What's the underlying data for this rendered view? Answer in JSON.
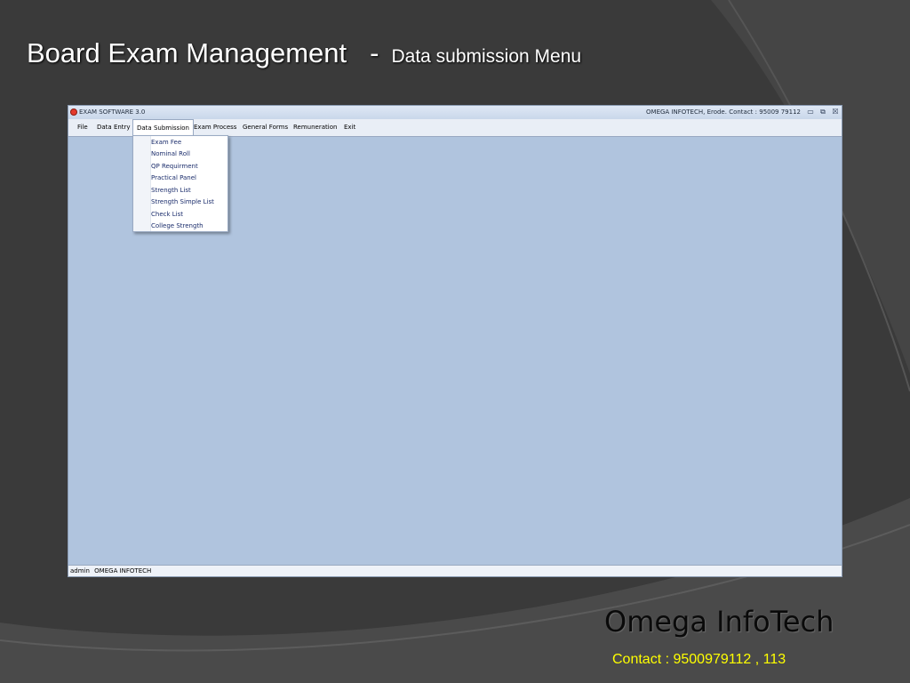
{
  "slide": {
    "title": "Board Exam Management",
    "dash": "-",
    "subtitle": "Data submission Menu",
    "company": "Omega  InfoTech",
    "contact": "Contact : 9500979112 , 113"
  },
  "window": {
    "title": "EXAM SOFTWARE 3.0",
    "contact": "OMEGA INFOTECH, Erode. Contact : 95009 79112",
    "minimize_icon": "minimize-icon",
    "restore_icon": "restore-icon",
    "close_icon": "close-icon"
  },
  "menubar": {
    "items": [
      "File",
      "Data Entry",
      "Data Submission",
      "Exam Process",
      "General Forms",
      "Remuneration",
      "Exit"
    ],
    "active": "Data Submission"
  },
  "dropdown": {
    "items": [
      "Exam Fee",
      "Nominal Roll",
      "QP Requirment",
      "Practical Panel",
      "Strength List",
      "Strength Simple List",
      "Check List",
      "College Strength"
    ]
  },
  "statusbar": {
    "user": "admin",
    "org": "OMEGA INFOTECH"
  },
  "colors": {
    "background": "#3a3a3a",
    "client_area": "#b0c4de",
    "contact_text": "#ffff00"
  }
}
